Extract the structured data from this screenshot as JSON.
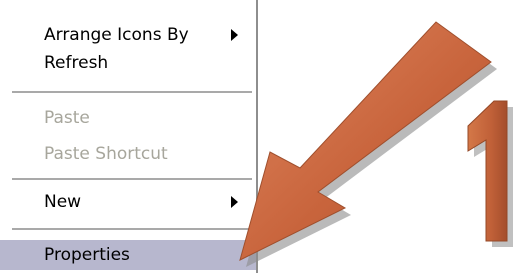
{
  "context_menu": {
    "items": [
      {
        "label": "Arrange Icons By",
        "has_submenu": true,
        "enabled": true
      },
      {
        "label": "Refresh",
        "has_submenu": false,
        "enabled": true
      },
      {
        "label": "Paste",
        "has_submenu": false,
        "enabled": false
      },
      {
        "label": "Paste Shortcut",
        "has_submenu": false,
        "enabled": false
      },
      {
        "label": "New",
        "has_submenu": true,
        "enabled": true
      },
      {
        "label": "Properties",
        "has_submenu": false,
        "enabled": true,
        "highlighted": true
      }
    ]
  },
  "annotation": {
    "step_number": "1",
    "arrow_color": "#c8643c",
    "highlight_color": "#b7b7ce",
    "disabled_text_color": "#a7a69c"
  }
}
